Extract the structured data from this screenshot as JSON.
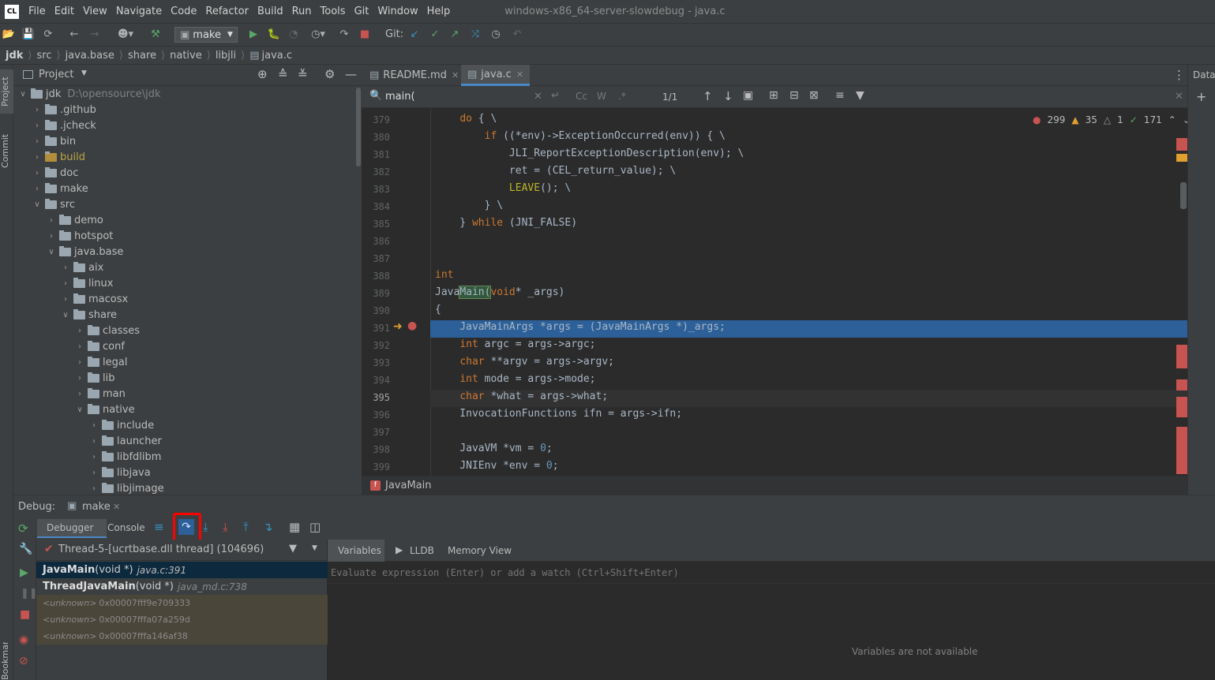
{
  "menubar": {
    "logo": "CL",
    "items": [
      "File",
      "Edit",
      "View",
      "Navigate",
      "Code",
      "Refactor",
      "Build",
      "Run",
      "Tools",
      "Git",
      "Window",
      "Help"
    ],
    "window_title": "windows-x86_64-server-slowdebug - java.c"
  },
  "toolbar": {
    "config": "make",
    "git_label": "Git:"
  },
  "breadcrumb": [
    "jdk",
    "src",
    "java.base",
    "share",
    "native",
    "libjli",
    "java.c"
  ],
  "sidebar": {
    "project_tab": "Project",
    "commit_tab": "Commit",
    "bookmarks_tab": "Bookmarks"
  },
  "project": {
    "title": "Project",
    "root": "jdk",
    "root_path": "D:\\opensource\\jdk",
    "tree": [
      {
        "label": "jdk",
        "hint": "D:\\opensource\\jdk",
        "depth": 0,
        "open": true
      },
      {
        "label": ".github",
        "depth": 1
      },
      {
        "label": ".jcheck",
        "depth": 1
      },
      {
        "label": "bin",
        "depth": 1
      },
      {
        "label": "build",
        "depth": 1,
        "excluded": true
      },
      {
        "label": "doc",
        "depth": 1
      },
      {
        "label": "make",
        "depth": 1
      },
      {
        "label": "src",
        "depth": 1,
        "open": true
      },
      {
        "label": "demo",
        "depth": 2
      },
      {
        "label": "hotspot",
        "depth": 2
      },
      {
        "label": "java.base",
        "depth": 2,
        "open": true
      },
      {
        "label": "aix",
        "depth": 3
      },
      {
        "label": "linux",
        "depth": 3
      },
      {
        "label": "macosx",
        "depth": 3
      },
      {
        "label": "share",
        "depth": 3,
        "open": true
      },
      {
        "label": "classes",
        "depth": 4
      },
      {
        "label": "conf",
        "depth": 4
      },
      {
        "label": "legal",
        "depth": 4
      },
      {
        "label": "lib",
        "depth": 4
      },
      {
        "label": "man",
        "depth": 4
      },
      {
        "label": "native",
        "depth": 4,
        "open": true
      },
      {
        "label": "include",
        "depth": 5
      },
      {
        "label": "launcher",
        "depth": 5
      },
      {
        "label": "libfdlibm",
        "depth": 5
      },
      {
        "label": "libjava",
        "depth": 5
      },
      {
        "label": "libjimage",
        "depth": 5
      }
    ]
  },
  "editor": {
    "tabs": [
      {
        "label": "README.md"
      },
      {
        "label": "java.c",
        "active": true
      }
    ],
    "search": {
      "query": "main(",
      "match": "1/1",
      "opt_cc": "Cc",
      "opt_w": "W",
      "opt_regex": ".*"
    },
    "inspections": {
      "errors": "299",
      "warnings": "35",
      "weak": "1",
      "ok": "171"
    },
    "lines": [
      {
        "n": "379",
        "c": "    do { \\"
      },
      {
        "n": "380",
        "c": "        if ((*env)->ExceptionOccurred(env)) { \\"
      },
      {
        "n": "381",
        "c": "            JLI_ReportExceptionDescription(env); \\"
      },
      {
        "n": "382",
        "c": "            ret = (CEL_return_value); \\"
      },
      {
        "n": "383",
        "c": "            LEAVE(); \\"
      },
      {
        "n": "384",
        "c": "        } \\"
      },
      {
        "n": "385",
        "c": "    } while (JNI_FALSE)"
      },
      {
        "n": "386",
        "c": ""
      },
      {
        "n": "387",
        "c": ""
      },
      {
        "n": "388",
        "c": "int"
      },
      {
        "n": "389",
        "c": "JavaMain(void* _args)"
      },
      {
        "n": "390",
        "c": "{"
      },
      {
        "n": "391",
        "c": "    JavaMainArgs *args = (JavaMainArgs *)_args;"
      },
      {
        "n": "392",
        "c": "    int argc = args->argc;"
      },
      {
        "n": "393",
        "c": "    char **argv = args->argv;"
      },
      {
        "n": "394",
        "c": "    int mode = args->mode;"
      },
      {
        "n": "395",
        "c": "    char *what = args->what;"
      },
      {
        "n": "396",
        "c": "    InvocationFunctions ifn = args->ifn;"
      },
      {
        "n": "397",
        "c": ""
      },
      {
        "n": "398",
        "c": "    JavaVM *vm = 0;"
      },
      {
        "n": "399",
        "c": "    JNIEnv *env = 0;"
      }
    ],
    "function_crumb": "JavaMain"
  },
  "right_panel": {
    "title": "Data"
  },
  "debug": {
    "label": "Debug:",
    "session": "make",
    "tabs": [
      "Debugger",
      "Console"
    ],
    "thread": "Thread-5-[ucrtbase.dll thread] (104696)",
    "frames": [
      {
        "fn": "JavaMain",
        "args": "(void *)",
        "loc": "java.c:391",
        "selected": true
      },
      {
        "fn": "ThreadJavaMain",
        "args": "(void *)",
        "loc": "java_md.c:738"
      },
      {
        "fn": "<unknown>",
        "addr": "0x00007fff9e709333"
      },
      {
        "fn": "<unknown>",
        "addr": "0x00007fffa07a259d"
      },
      {
        "fn": "<unknown>",
        "addr": "0x00007fffa146af38"
      }
    ],
    "var_tabs": [
      "Variables",
      "LLDB",
      "Memory View"
    ],
    "eval_placeholder": "Evaluate expression (Enter) or add a watch (Ctrl+Shift+Enter)",
    "empty_msg": "Variables are not available"
  },
  "colors": {
    "accent": "#2d6099",
    "highlight_box": "#ff0000",
    "error": "#c75450",
    "warning": "#e0a030"
  }
}
